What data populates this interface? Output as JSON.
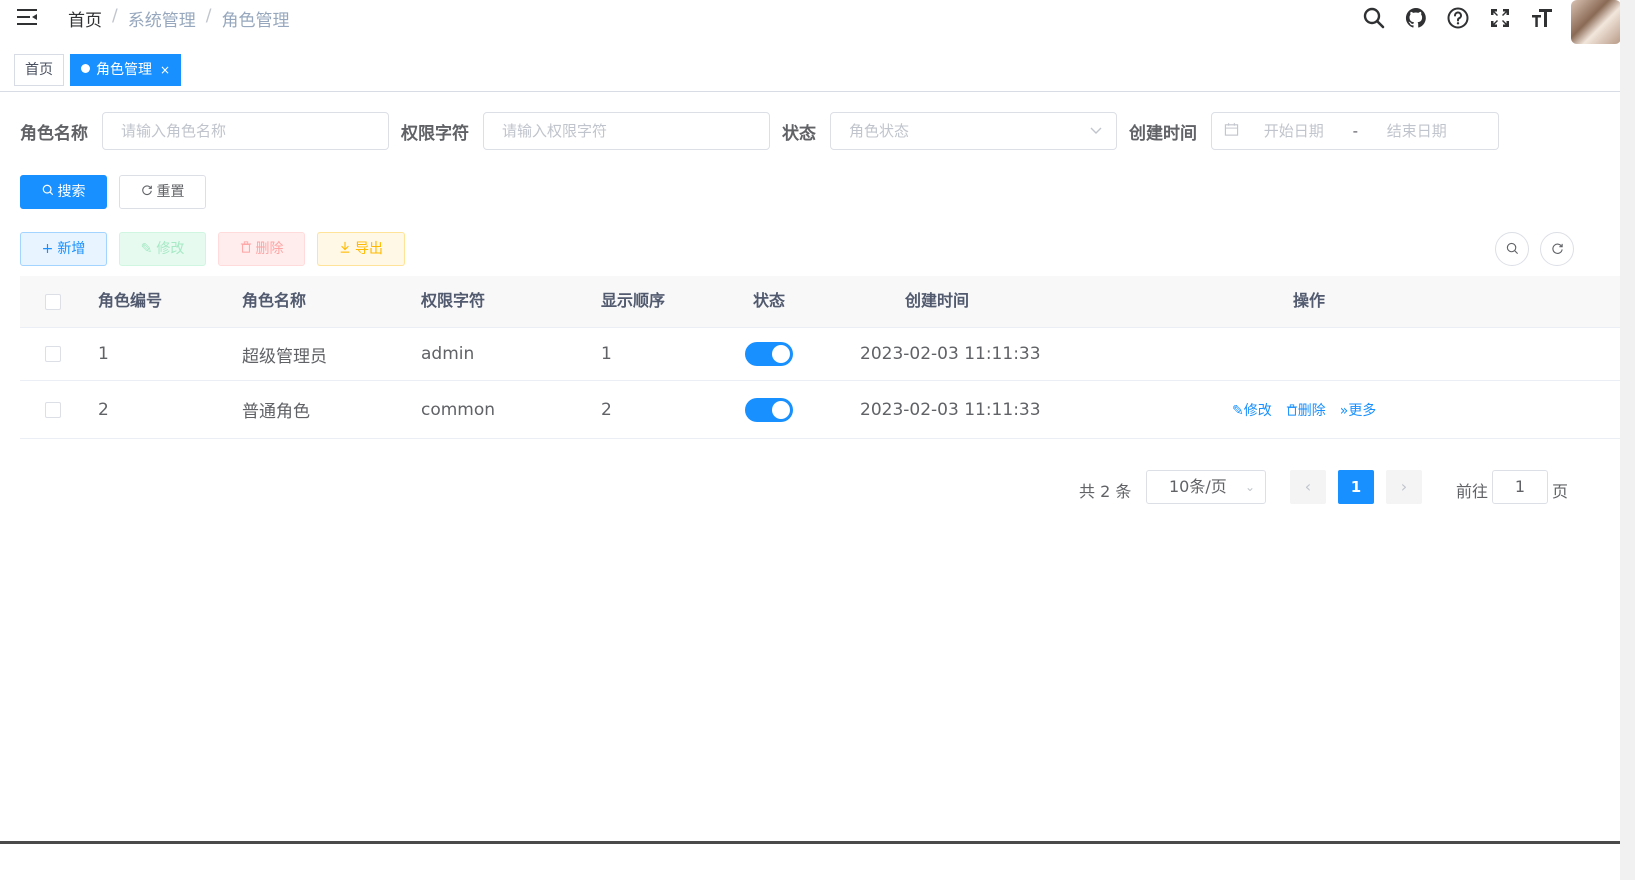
{
  "navbar": {
    "breadcrumb": [
      "首页",
      "系统管理",
      "角色管理"
    ],
    "breadcrumb_separator": "/",
    "icons": [
      "search-icon",
      "github-icon",
      "question-icon",
      "fullscreen-icon",
      "font-size-icon"
    ]
  },
  "tags": {
    "home": "首页",
    "active": "角色管理",
    "close": "×"
  },
  "form": {
    "role_name_label": "角色名称",
    "role_name_placeholder": "请输入角色名称",
    "perm_label": "权限字符",
    "perm_placeholder": "请输入权限字符",
    "status_label": "状态",
    "status_placeholder": "角色状态",
    "created_label": "创建时间",
    "start_placeholder": "开始日期",
    "range_sep": "-",
    "end_placeholder": "结束日期",
    "search_label": "搜索",
    "reset_label": "重置"
  },
  "toolbar": {
    "add_label": "新增",
    "edit_label": "修改",
    "delete_label": "删除",
    "export_label": "导出"
  },
  "table": {
    "columns": [
      "角色编号",
      "角色名称",
      "权限字符",
      "显示顺序",
      "状态",
      "创建时间",
      "操作"
    ],
    "rows": [
      {
        "id": "1",
        "name": "超级管理员",
        "key": "admin",
        "sort": "1",
        "status_on": true,
        "created": "2023-02-03 11:11:33"
      },
      {
        "id": "2",
        "name": "普通角色",
        "key": "common",
        "sort": "2",
        "status_on": true,
        "created": "2023-02-03 11:11:33",
        "actions": {
          "edit": "修改",
          "delete": "删除",
          "more": "更多"
        }
      }
    ]
  },
  "pagination": {
    "total": "共 2 条",
    "page_size": "10条/页",
    "current_page": "1",
    "goto_label": "前往",
    "goto_value": "1",
    "page_unit": "页"
  },
  "colors": {
    "primary": "#1890ff",
    "header_bg": "#f8f8f9"
  }
}
